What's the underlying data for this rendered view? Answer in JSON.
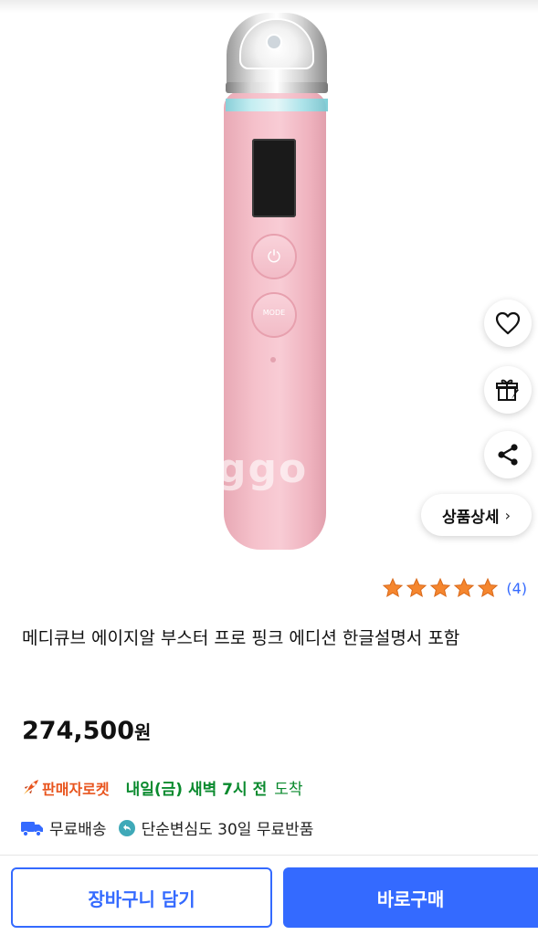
{
  "product_image": {
    "alt": "메디큐브 에이지알 부스터 프로 핑크",
    "device_button_label": "MODE",
    "watermark": "ggo"
  },
  "side_actions": {
    "wishlist_icon": "heart-icon",
    "gift_icon": "gift-icon",
    "share_icon": "share-icon",
    "detail_label": "상품상세",
    "detail_chevron": "›"
  },
  "rating": {
    "stars": 5,
    "max_stars": 5,
    "review_count": "(4)",
    "star_color": "#f5862e"
  },
  "product": {
    "title": "메디큐브 에이지알 부스터 프로 핑크 에디션 한글설명서 포함",
    "price_number": "274,500",
    "price_unit": "원"
  },
  "delivery": {
    "rocket_label": "판매자로켓",
    "arrival_strong": "내일(금) 새벽 7시 전",
    "arrival_rest": "도착",
    "free_shipping": "무료배송",
    "free_return": "단순변심도 30일 무료반품"
  },
  "actions": {
    "cart_label": "장바구니 담기",
    "buy_label": "바로구매"
  },
  "colors": {
    "accent": "#346aff",
    "arrival_green": "#0a8a2e",
    "rocket_orange": "#e8541d"
  }
}
